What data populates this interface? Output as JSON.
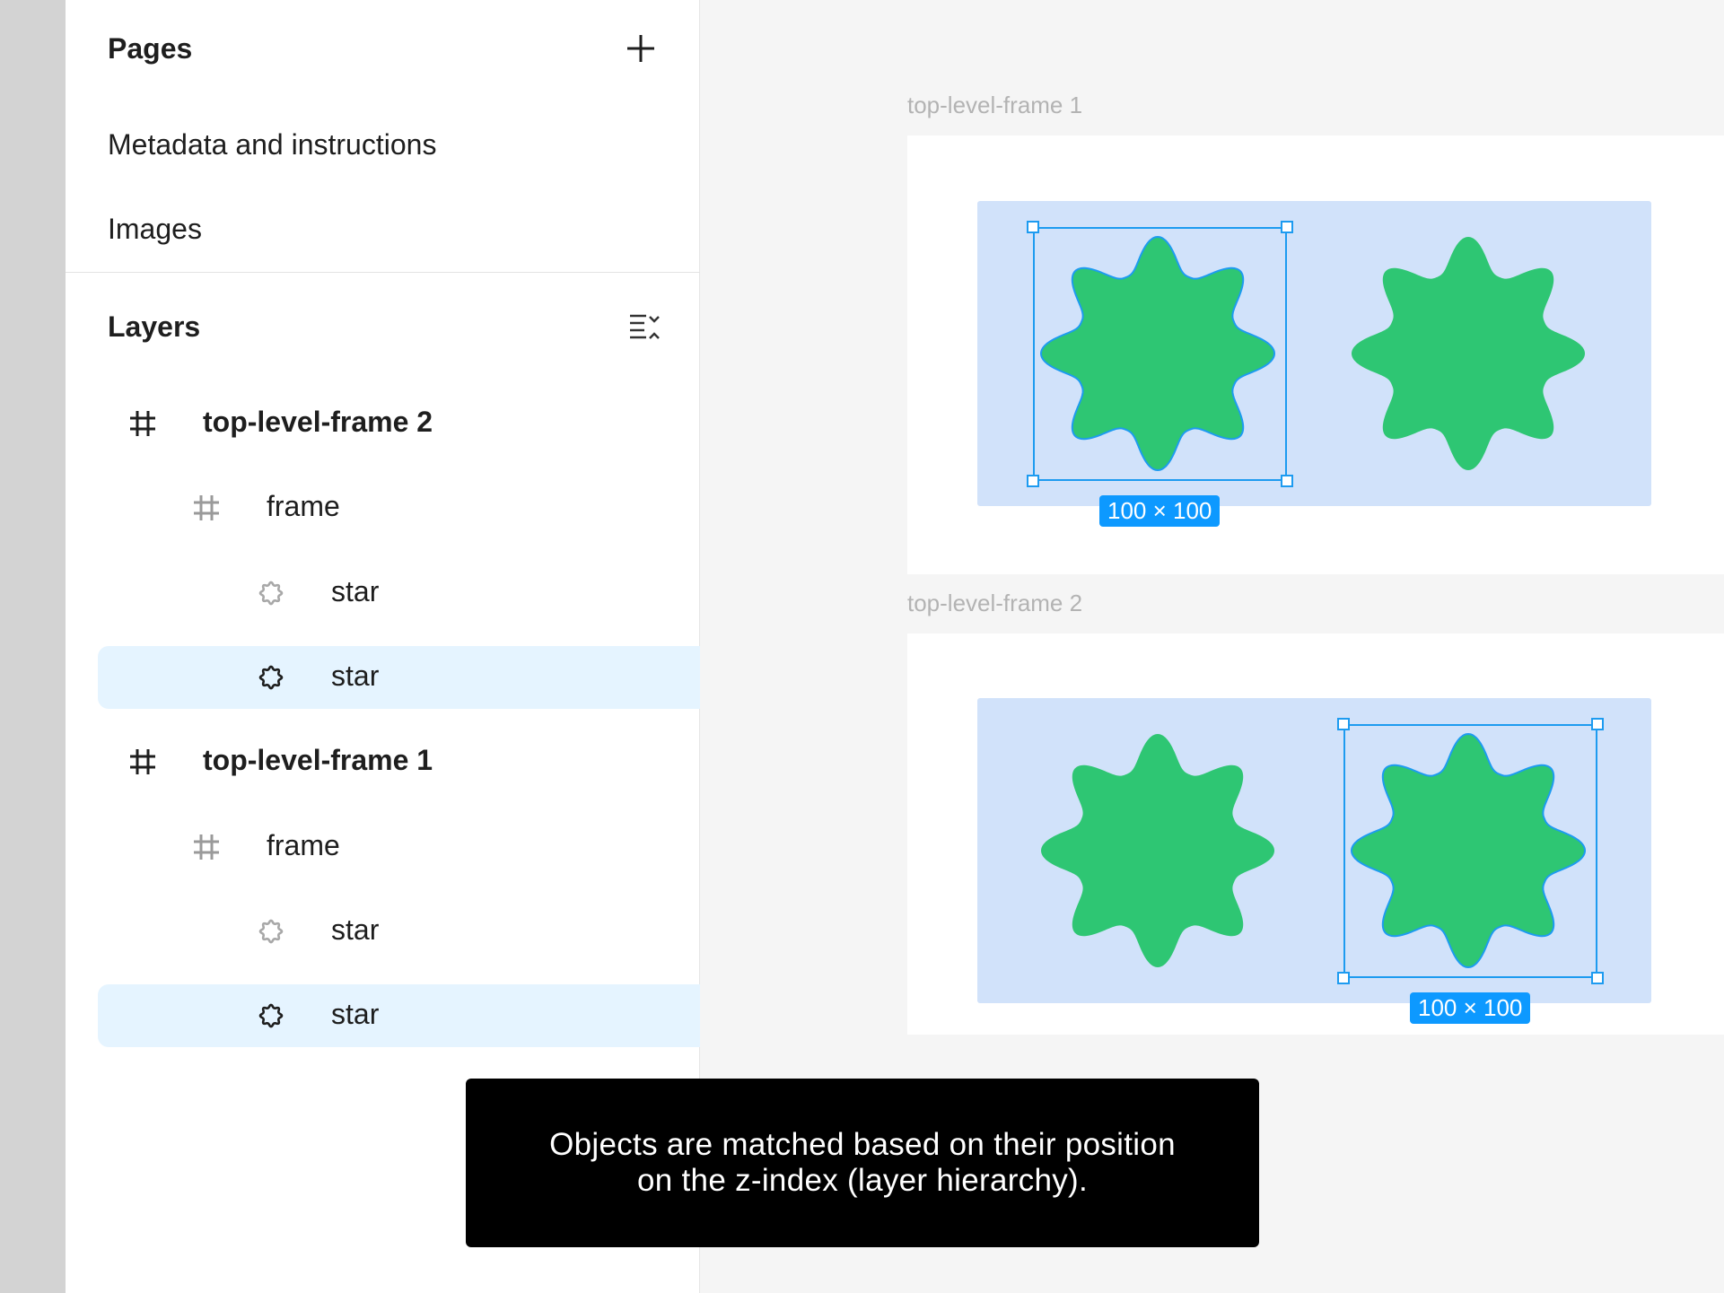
{
  "sidebar": {
    "pages_title": "Pages",
    "pages": [
      "Metadata and instructions",
      "Images"
    ],
    "layers_title": "Layers",
    "layers": [
      {
        "label": "top-level-frame 2",
        "type": "frame",
        "depth": 0,
        "selected": false,
        "bold": true
      },
      {
        "label": "frame",
        "type": "frame",
        "depth": 1,
        "selected": false,
        "bold": false
      },
      {
        "label": "star",
        "type": "star",
        "depth": 2,
        "selected": false,
        "bold": false
      },
      {
        "label": "star",
        "type": "star",
        "depth": 2,
        "selected": true,
        "bold": false
      },
      {
        "label": "top-level-frame 1",
        "type": "frame",
        "depth": 0,
        "selected": false,
        "bold": true
      },
      {
        "label": "frame",
        "type": "frame",
        "depth": 1,
        "selected": false,
        "bold": false
      },
      {
        "label": "star",
        "type": "star",
        "depth": 2,
        "selected": false,
        "bold": false
      },
      {
        "label": "star",
        "type": "star",
        "depth": 2,
        "selected": true,
        "bold": false
      }
    ]
  },
  "canvas": {
    "frames": [
      {
        "title": "top-level-frame 1",
        "dimension_badge": "100 × 100",
        "selected_star": "left"
      },
      {
        "title": "top-level-frame 2",
        "dimension_badge": "100 × 100",
        "selected_star": "right"
      }
    ]
  },
  "caption": {
    "line1": "Objects are matched based on their position",
    "line2": "on the z-index (layer hierarchy)."
  },
  "colors": {
    "star_fill": "#2ec673",
    "inner_frame": "#d1e2fa",
    "selection": "#1d9bf0",
    "badge": "#0d99ff",
    "selected_row": "#e5f4ff"
  }
}
